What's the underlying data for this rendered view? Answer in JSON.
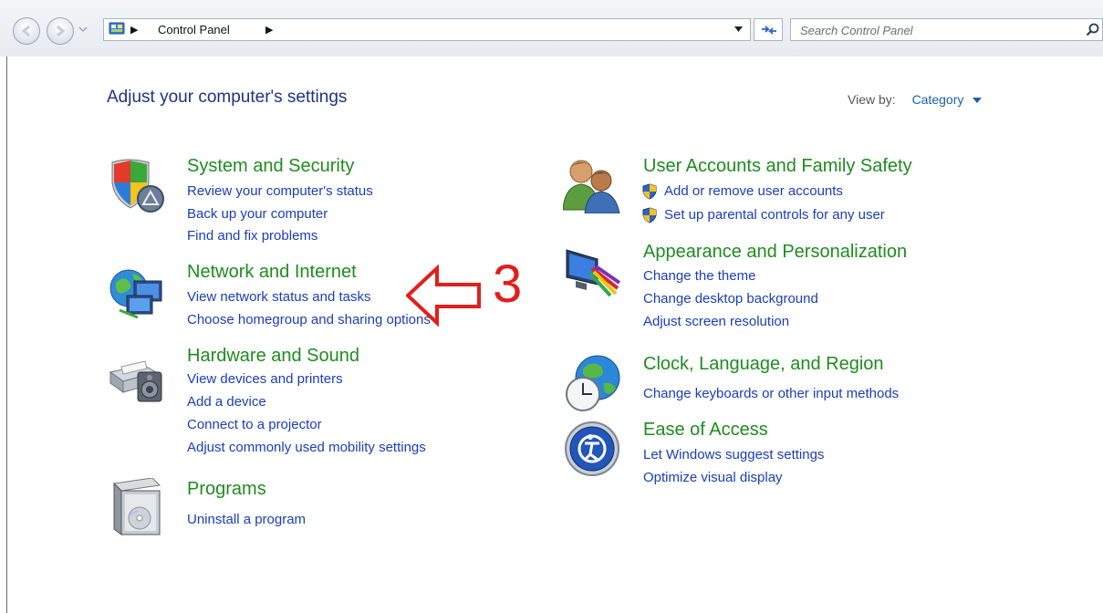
{
  "address_bar": {
    "crumb": "Control Panel",
    "search_placeholder": "Search Control Panel"
  },
  "header": {
    "title": "Adjust your computer's settings",
    "view_by_label": "View by:",
    "view_by_value": "Category"
  },
  "categories": {
    "system": {
      "title": "System and Security",
      "links": [
        "Review your computer's status",
        "Back up your computer",
        "Find and fix problems"
      ]
    },
    "network": {
      "title": "Network and Internet",
      "links": [
        "View network status and tasks",
        "Choose homegroup and sharing options"
      ]
    },
    "hardware": {
      "title": "Hardware and Sound",
      "links": [
        "View devices and printers",
        "Add a device",
        "Connect to a projector",
        "Adjust commonly used mobility settings"
      ]
    },
    "programs": {
      "title": "Programs",
      "links": [
        "Uninstall a program"
      ]
    },
    "users": {
      "title": "User Accounts and Family Safety",
      "links": [
        "Add or remove user accounts",
        "Set up parental controls for any user"
      ]
    },
    "appearance": {
      "title": "Appearance and Personalization",
      "links": [
        "Change the theme",
        "Change desktop background",
        "Adjust screen resolution"
      ]
    },
    "clock": {
      "title": "Clock, Language, and Region",
      "links": [
        "Change keyboards or other input methods"
      ]
    },
    "ease": {
      "title": "Ease of Access",
      "links": [
        "Let Windows suggest settings",
        "Optimize visual display"
      ]
    }
  },
  "annotation": {
    "number": "3"
  },
  "colors": {
    "category_title": "#1e8c1e",
    "link": "#1a3dbd",
    "page_title": "#1e3287",
    "annotation": "#e0201b"
  },
  "icons": {
    "system": "shield-icon",
    "network": "network-globe-icon",
    "hardware": "printer-speaker-icon",
    "programs": "program-box-icon",
    "users": "users-icon",
    "appearance": "monitor-palette-icon",
    "clock": "clock-globe-icon",
    "ease": "ease-of-access-icon"
  }
}
